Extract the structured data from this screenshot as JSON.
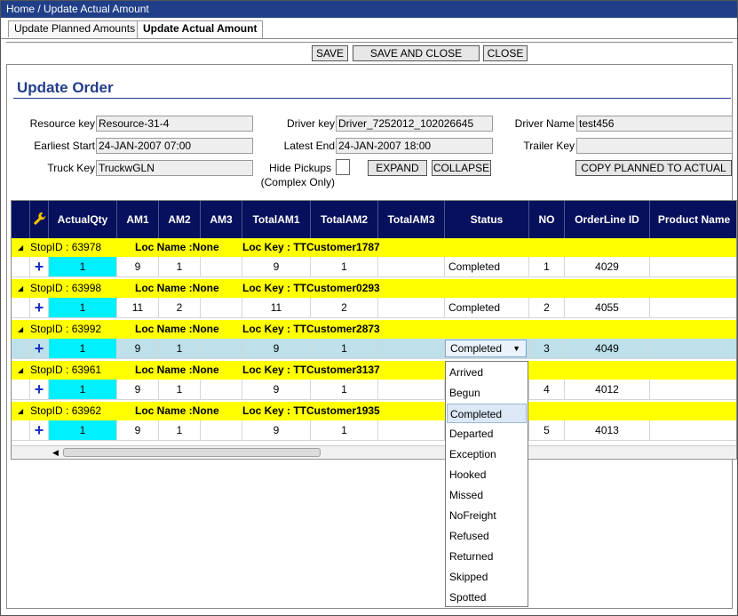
{
  "breadcrumb": "Home / Update Actual Amount",
  "tabs": [
    {
      "label": "Update Planned Amounts"
    },
    {
      "label": "Update Actual Amount"
    }
  ],
  "toolbar": {
    "save": "SAVE",
    "save_close": "SAVE AND CLOSE",
    "close": "CLOSE"
  },
  "section_title": "Update Order",
  "form": {
    "resource_key_label": "Resource key",
    "resource_key": "Resource-31-4",
    "earliest_start_label": "Earliest Start",
    "earliest_start": "24-JAN-2007 07:00",
    "truck_key_label": "Truck Key",
    "truck_key": "TruckwGLN",
    "driver_key_label": "Driver key",
    "driver_key": "Driver_7252012_102026645",
    "latest_end_label": "Latest End",
    "latest_end": "24-JAN-2007 18:00",
    "hide_pickups_label": "Hide Pickups",
    "hide_pickups_note": "(Complex Only)",
    "driver_name_label": "Driver Name",
    "driver_name": "test456",
    "trailer_key_label": "Trailer Key",
    "trailer_key": "",
    "expand": "EXPAND",
    "collapse": "COLLAPSE",
    "copy_planned": "COPY PLANNED TO ACTUAL"
  },
  "grid": {
    "columns": [
      "ActualQty",
      "AM1",
      "AM2",
      "AM3",
      "TotalAM1",
      "TotalAM2",
      "TotalAM3",
      "Status",
      "NO",
      "OrderLine ID",
      "Product Name"
    ],
    "groups": [
      {
        "stop": "StopID : 63978",
        "loc_name": "Loc Name :None",
        "loc_key": "Loc Key : TTCustomer1787",
        "row": {
          "qty": "1",
          "am1": "9",
          "am2": "1",
          "am3": "",
          "t1": "9",
          "t2": "1",
          "t3": "",
          "status": "Completed",
          "no": "1",
          "olid": "4029",
          "product": ""
        }
      },
      {
        "stop": "StopID : 63998",
        "loc_name": "Loc Name :None",
        "loc_key": "Loc Key : TTCustomer0293",
        "row": {
          "qty": "1",
          "am1": "11",
          "am2": "2",
          "am3": "",
          "t1": "11",
          "t2": "2",
          "t3": "",
          "status": "Completed",
          "no": "2",
          "olid": "4055",
          "product": ""
        }
      },
      {
        "stop": "StopID : 63992",
        "loc_name": "Loc Name :None",
        "loc_key": "Loc Key : TTCustomer2873",
        "row": {
          "qty": "1",
          "am1": "9",
          "am2": "1",
          "am3": "",
          "t1": "9",
          "t2": "1",
          "t3": "",
          "status": "Completed",
          "no": "3",
          "olid": "4049",
          "product": ""
        }
      },
      {
        "stop": "StopID : 63961",
        "loc_name": "Loc Name :None",
        "loc_key": "Loc Key : TTCustomer3137",
        "row": {
          "qty": "1",
          "am1": "9",
          "am2": "1",
          "am3": "",
          "t1": "9",
          "t2": "1",
          "t3": "",
          "status": "",
          "no": "4",
          "olid": "4012",
          "product": ""
        }
      },
      {
        "stop": "StopID : 63962",
        "loc_name": "Loc Name :None",
        "loc_key": "Loc Key : TTCustomer1935",
        "row": {
          "qty": "1",
          "am1": "9",
          "am2": "1",
          "am3": "",
          "t1": "9",
          "t2": "1",
          "t3": "",
          "status": "",
          "no": "5",
          "olid": "4013",
          "product": ""
        }
      }
    ]
  },
  "status_dropdown": {
    "selected": "Completed",
    "options": [
      "Arrived",
      "Begun",
      "Completed",
      "Departed",
      "Exception",
      "Hooked",
      "Missed",
      "NoFreight",
      "Refused",
      "Returned",
      "Skipped",
      "Spotted"
    ]
  },
  "colors": {
    "header": "#07105c",
    "group_row": "#ffff00",
    "qty_cell": "#00f0ff",
    "title": "#223d8a"
  }
}
